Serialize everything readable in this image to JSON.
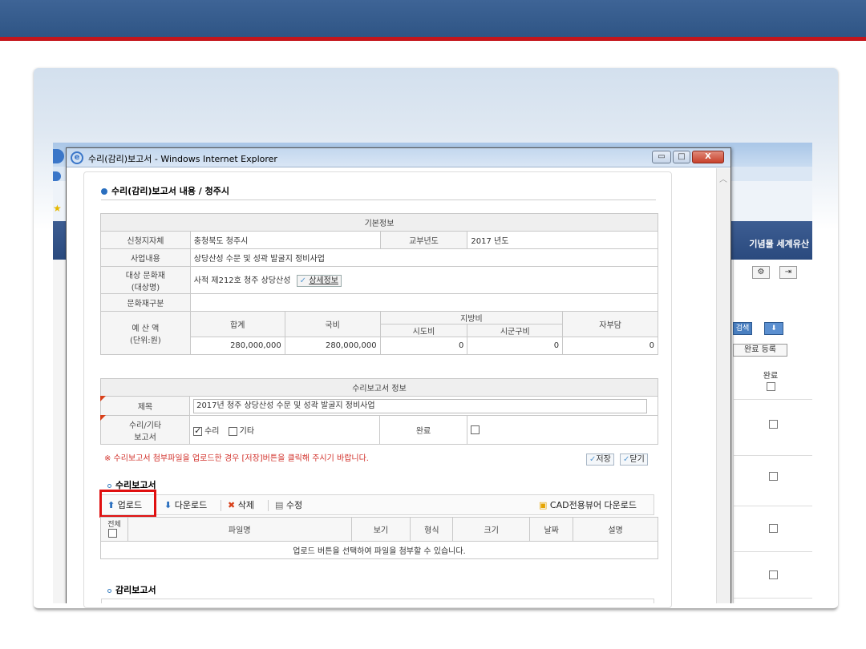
{
  "browser_window": {
    "title": "수리(감리)보고서 - Windows Internet Explorer",
    "minimize_label": "▭",
    "maximize_label": "□",
    "close_label": "X"
  },
  "background_page": {
    "nav_text": "기념물 세계유산",
    "search_btn": "검색",
    "done_register_btn": "완료 등록",
    "done_column_header": "완료",
    "gear_icon_glyph": "⚙",
    "arrow_icon_glyph": "⇥"
  },
  "page": {
    "heading": "수리(감리)보고서 내용 / 청주시"
  },
  "basic_info": {
    "section_header": "기본정보",
    "rows": {
      "applicant_label": "신청지자체",
      "applicant_value": "충청북도 청주시",
      "grant_year_label": "교부년도",
      "grant_year_value": "2017 년도",
      "project_label": "사업내용",
      "project_value": "상당산성 수문 및 성곽 발굴지 정비사업",
      "heritage_label_1": "대상 문화재",
      "heritage_label_2": "(대상명)",
      "heritage_value": "사적 제212호 청주 상당산성",
      "detail_button": "상세정보",
      "category_label": "문화재구분",
      "category_value": ""
    },
    "budget": {
      "label_1": "예 산 액",
      "label_2": "(단위:원)",
      "total_label": "합계",
      "national_label": "국비",
      "local_label": "지방비",
      "province_label": "시도비",
      "city_label": "시군구비",
      "self_label": "자부담",
      "total_value": "280,000,000",
      "national_value": "280,000,000",
      "province_value": "0",
      "city_value": "0",
      "self_value": "0"
    }
  },
  "report_info": {
    "section_header": "수리보고서 정보",
    "title_label": "제목",
    "title_value": "2017년 청주 상당산성 수문 및 성곽 발굴지 정비사업",
    "type_label_1": "수리/기타",
    "type_label_2": "보고서",
    "type_repair": "수리",
    "type_other": "기타",
    "type_repair_checked": true,
    "type_other_checked": false,
    "done_label": "완료",
    "done_checked": false
  },
  "notice": "※ 수리보고서 첨부파일을 업로드한 경우 [저장]버튼을 클릭해 주시기 바랍니다.",
  "actions": {
    "save": "저장",
    "close": "닫기"
  },
  "repair_report": {
    "section_title": "수리보고서",
    "toolbar": {
      "upload": "업로드",
      "download": "다운로드",
      "delete": "삭제",
      "edit": "수정",
      "cad_viewer": "CAD전용뷰어 다운로드"
    },
    "columns": [
      "전체",
      "파일명",
      "보기",
      "형식",
      "크기",
      "날짜",
      "설명"
    ],
    "empty_message": "업로드 버튼을 선택하여 파일을 첨부할 수 있습니다."
  },
  "supervision_report": {
    "section_title": "감리보고서"
  },
  "colors": {
    "slide_header": "#2f5585",
    "slide_accent_red": "#c4161c",
    "highlight_red": "#e01010",
    "notice_red": "#d2302a"
  }
}
